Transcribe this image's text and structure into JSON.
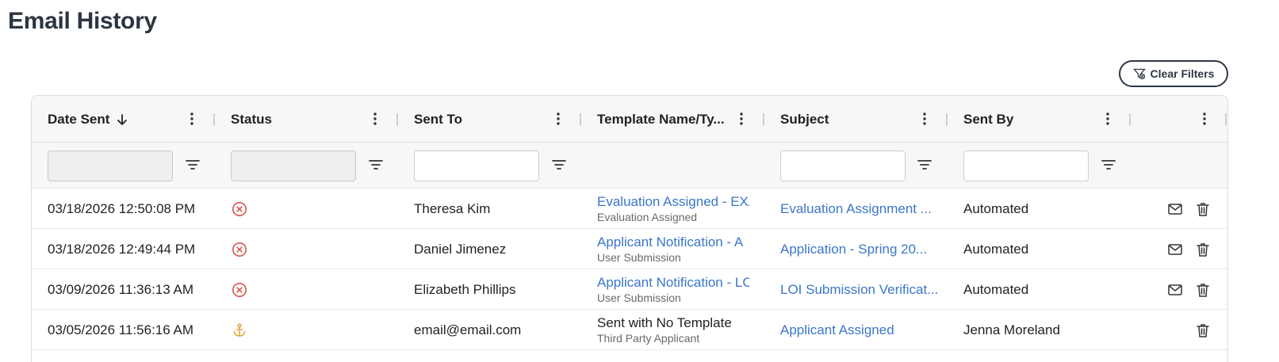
{
  "page": {
    "title": "Email History"
  },
  "toolbar": {
    "clear_filters_label": "Clear Filters"
  },
  "columns": [
    {
      "key": "date_sent",
      "label": "Date Sent",
      "sort": "descending"
    },
    {
      "key": "status",
      "label": "Status"
    },
    {
      "key": "sent_to",
      "label": "Sent To"
    },
    {
      "key": "template",
      "label": "Template Name/Ty..."
    },
    {
      "key": "subject",
      "label": "Subject"
    },
    {
      "key": "sent_by",
      "label": "Sent By"
    },
    {
      "key": "actions",
      "label": ""
    }
  ],
  "filters": {
    "date_sent": "",
    "status": "",
    "sent_to": "",
    "subject": "",
    "sent_by": ""
  },
  "rows": [
    {
      "date_sent": "03/18/2026 12:50:08 PM",
      "status": "failed",
      "status_icon": "x-circle-icon",
      "status_color": "#d9534f",
      "sent_to": "Theresa Kim",
      "template_name": "Evaluation Assigned - EXA",
      "template_type": "Evaluation Assigned",
      "template_is_link": true,
      "subject": "Evaluation Assignment ...",
      "sent_by": "Automated",
      "resend": true
    },
    {
      "date_sent": "03/18/2026 12:49:44 PM",
      "status": "failed",
      "status_icon": "x-circle-icon",
      "status_color": "#d9534f",
      "sent_to": "Daniel Jimenez",
      "template_name": "Applicant Notification - A",
      "template_type": "User Submission",
      "template_is_link": true,
      "subject": "Application - Spring 20...",
      "sent_by": "Automated",
      "resend": true
    },
    {
      "date_sent": "03/09/2026 11:36:13 AM",
      "status": "failed",
      "status_icon": "x-circle-icon",
      "status_color": "#d9534f",
      "sent_to": "Elizabeth Phillips",
      "template_name": "Applicant Notification - LC",
      "template_type": "User Submission",
      "template_is_link": true,
      "subject": "LOI Submission Verificat...",
      "sent_by": "Automated",
      "resend": true
    },
    {
      "date_sent": "03/05/2026 11:56:16 AM",
      "status": "other",
      "status_icon": "anchor-icon",
      "status_color": "#e0a93a",
      "sent_to": "email@email.com",
      "template_name": "Sent with No Template",
      "template_type": "Third Party Applicant",
      "template_is_link": false,
      "subject": "Applicant Assigned",
      "sent_by": "Jenna Moreland",
      "resend": false
    }
  ],
  "colors": {
    "link": "#3b76c9",
    "error": "#d9534f",
    "warning": "#e0a93a",
    "title": "#2b3540"
  }
}
